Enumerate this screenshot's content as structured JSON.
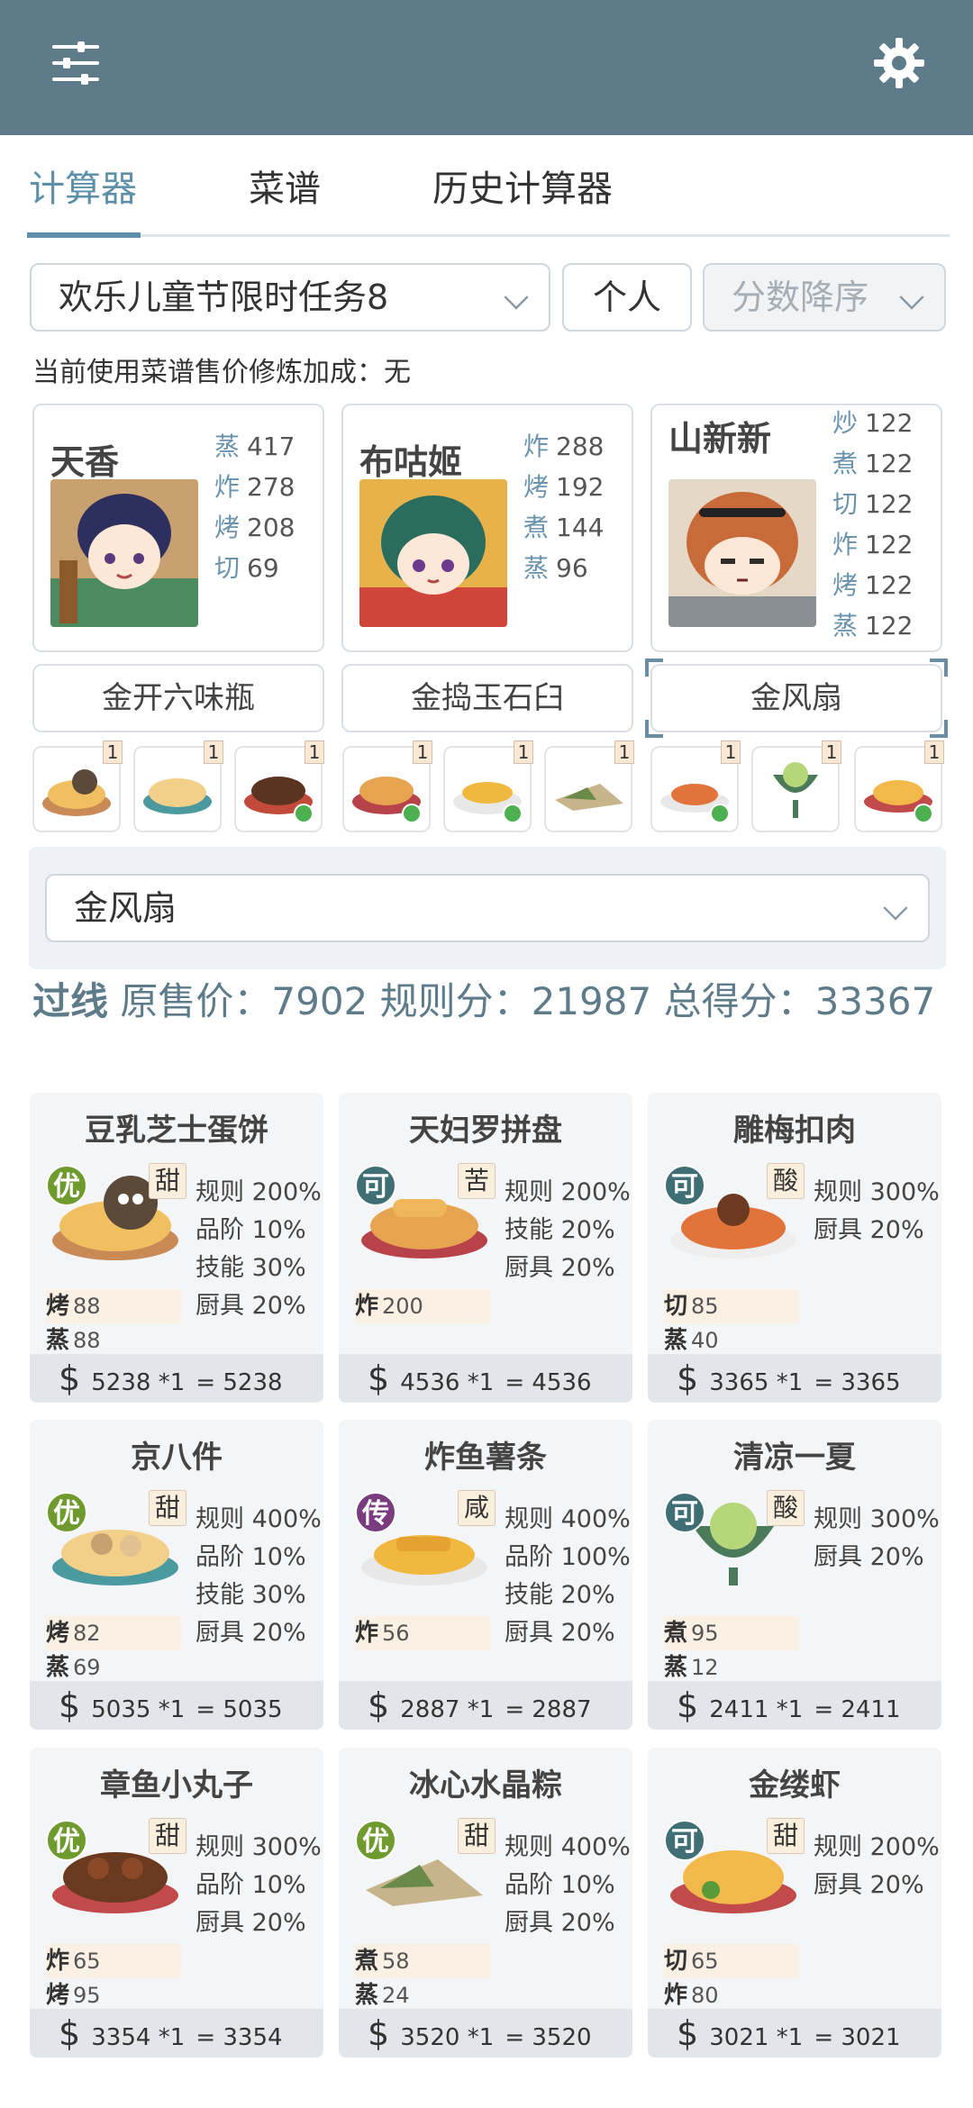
{
  "topbar": {
    "menu_icon": "sliders-icon",
    "settings_icon": "gear-icon"
  },
  "tabs": [
    {
      "label": "计算器",
      "active": true
    },
    {
      "label": "菜谱",
      "active": false
    },
    {
      "label": "历史计算器",
      "active": false
    }
  ],
  "filters": {
    "task": "欢乐儿童节限时任务8",
    "mode": "个人",
    "sort": "分数降序"
  },
  "info_line": "当前使用菜谱售价修炼加成：无",
  "chefs": [
    {
      "name": "天香",
      "stats": [
        {
          "k": "蒸",
          "v": "417"
        },
        {
          "k": "炸",
          "v": "278"
        },
        {
          "k": "烤",
          "v": "208"
        },
        {
          "k": "切",
          "v": "69"
        }
      ]
    },
    {
      "name": "布咕姬",
      "stats": [
        {
          "k": "炸",
          "v": "288"
        },
        {
          "k": "烤",
          "v": "192"
        },
        {
          "k": "煮",
          "v": "144"
        },
        {
          "k": "蒸",
          "v": "96"
        }
      ]
    },
    {
      "name": "山新新",
      "stats": [
        {
          "k": "炒",
          "v": "122"
        },
        {
          "k": "煮",
          "v": "122"
        },
        {
          "k": "切",
          "v": "122"
        },
        {
          "k": "炸",
          "v": "122"
        },
        {
          "k": "烤",
          "v": "122"
        },
        {
          "k": "蒸",
          "v": "122"
        }
      ]
    }
  ],
  "tools": [
    "金开六味瓶",
    "金捣玉石臼",
    "金风扇"
  ],
  "dish_thumbs": [
    {
      "count": "1",
      "check": false
    },
    {
      "count": "1",
      "check": false
    },
    {
      "count": "1",
      "check": true
    },
    {
      "count": "1",
      "check": true
    },
    {
      "count": "1",
      "check": true
    },
    {
      "count": "1",
      "check": false
    },
    {
      "count": "1",
      "check": true
    },
    {
      "count": "1",
      "check": false
    },
    {
      "count": "1",
      "check": true
    }
  ],
  "tool_select": "金风扇",
  "summary": {
    "tag": "过线",
    "text": "原售价：7902 规则分：21987 总得分：33367"
  },
  "cards": [
    {
      "title": "豆乳芝士蛋饼",
      "grade": "优",
      "grade_color": "#6e9a2e",
      "flavor": "甜",
      "rules": [
        "规则 200%",
        "品阶 10%",
        "技能 30%",
        "厨具 20%"
      ],
      "skills": [
        {
          "k": "烤",
          "v": "88"
        },
        {
          "k": "蒸",
          "v": "88"
        }
      ],
      "price_base": "5238 *1",
      "price_eq": "= 5238"
    },
    {
      "title": "天妇罗拼盘",
      "grade": "可",
      "grade_color": "#3f6f75",
      "flavor": "苦",
      "rules": [
        "规则 200%",
        "技能 20%",
        "厨具 20%"
      ],
      "skills": [
        {
          "k": "炸",
          "v": "200"
        }
      ],
      "price_base": "4536 *1",
      "price_eq": "= 4536"
    },
    {
      "title": "雕梅扣肉",
      "grade": "可",
      "grade_color": "#3f6f75",
      "flavor": "酸",
      "rules": [
        "规则 300%",
        "厨具 20%"
      ],
      "skills": [
        {
          "k": "切",
          "v": "85"
        },
        {
          "k": "蒸",
          "v": "40"
        }
      ],
      "price_base": "3365 *1",
      "price_eq": "= 3365"
    },
    {
      "title": "京八件",
      "grade": "优",
      "grade_color": "#6e9a2e",
      "flavor": "甜",
      "rules": [
        "规则 400%",
        "品阶 10%",
        "技能 30%",
        "厨具 20%"
      ],
      "skills": [
        {
          "k": "烤",
          "v": "82"
        },
        {
          "k": "蒸",
          "v": "69"
        }
      ],
      "price_base": "5035 *1",
      "price_eq": "= 5035"
    },
    {
      "title": "炸鱼薯条",
      "grade": "传",
      "grade_color": "#7a3b7f",
      "flavor": "咸",
      "rules": [
        "规则 400%",
        "品阶 100%",
        "技能 20%",
        "厨具 20%"
      ],
      "skills": [
        {
          "k": "炸",
          "v": "56"
        }
      ],
      "price_base": "2887 *1",
      "price_eq": "= 2887"
    },
    {
      "title": "清凉一夏",
      "grade": "可",
      "grade_color": "#3f6f75",
      "flavor": "酸",
      "rules": [
        "规则 300%",
        "厨具 20%"
      ],
      "skills": [
        {
          "k": "煮",
          "v": "95"
        },
        {
          "k": "蒸",
          "v": "12"
        }
      ],
      "price_base": "2411 *1",
      "price_eq": "= 2411"
    },
    {
      "title": "章鱼小丸子",
      "grade": "优",
      "grade_color": "#6e9a2e",
      "flavor": "甜",
      "rules": [
        "规则 300%",
        "品阶 10%",
        "厨具 20%"
      ],
      "skills": [
        {
          "k": "炸",
          "v": "65"
        },
        {
          "k": "烤",
          "v": "95"
        }
      ],
      "price_base": "3354 *1",
      "price_eq": "= 3354"
    },
    {
      "title": "冰心水晶粽",
      "grade": "优",
      "grade_color": "#6e9a2e",
      "flavor": "甜",
      "rules": [
        "规则 400%",
        "品阶 10%",
        "厨具 20%"
      ],
      "skills": [
        {
          "k": "煮",
          "v": "58"
        },
        {
          "k": "蒸",
          "v": "24"
        }
      ],
      "price_base": "3520 *1",
      "price_eq": "= 3520"
    },
    {
      "title": "金缕虾",
      "grade": "可",
      "grade_color": "#3f6f75",
      "flavor": "甜",
      "rules": [
        "规则 200%",
        "厨具 20%"
      ],
      "skills": [
        {
          "k": "切",
          "v": "65"
        },
        {
          "k": "炸",
          "v": "80"
        }
      ],
      "price_base": "3021 *1",
      "price_eq": "= 3021"
    }
  ]
}
